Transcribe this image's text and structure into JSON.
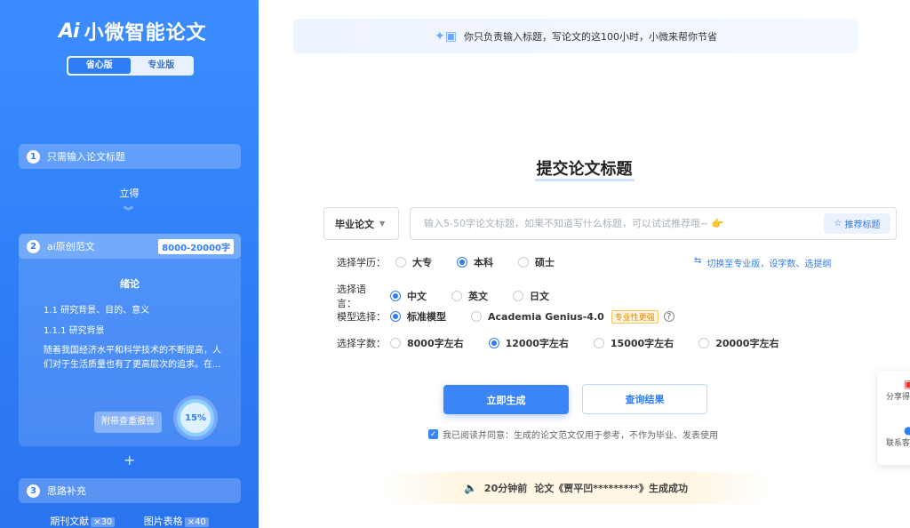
{
  "sidebar": {
    "logo_mark": "Ai",
    "logo_text": "小微智能论文",
    "modes": [
      {
        "label": "省心版",
        "active": true
      },
      {
        "label": "专业版",
        "active": false
      }
    ],
    "step1": {
      "num": "1",
      "label": "只需输入论文标题"
    },
    "standing": "立得",
    "step2": {
      "num": "2",
      "label": "ai原创范文",
      "tag": "8000-20000字"
    },
    "draft": {
      "title": "绪论",
      "line1": "1.1 研究背景、目的、意义",
      "line2": "1.1.1 研究背景",
      "body": "随着我国经济水平和科学技术的不断提高，人们对于生活质量也有了更高层次的追求。在..."
    },
    "report_label": "附带查重报告",
    "progress": "15%",
    "step3": {
      "num": "3",
      "label": "思路补充"
    },
    "extras": [
      {
        "label": "期刊文献",
        "count": "×30"
      },
      {
        "label": "图片表格",
        "count": "×40"
      }
    ]
  },
  "banner": {
    "text": "你只负责输入标题，写论文的这100小时，小微来帮你节省"
  },
  "main": {
    "heading": "提交论文标题",
    "type_select": "毕业论文",
    "input_placeholder": "输入5-50字论文标题，如果不知道写什么标题，可以试试推荐哦~ 👉",
    "recommend_label": "推荐标题",
    "switch_link": "切换至专业版，设字数、选提纲",
    "education": {
      "label": "选择学历：",
      "options": [
        {
          "label": "大专",
          "checked": false
        },
        {
          "label": "本科",
          "checked": true
        },
        {
          "label": "硕士",
          "checked": false
        }
      ]
    },
    "language": {
      "label": "选择语言：",
      "options": [
        {
          "label": "中文",
          "checked": true
        },
        {
          "label": "英文",
          "checked": false
        },
        {
          "label": "日文",
          "checked": false
        }
      ]
    },
    "model": {
      "label": "模型选择：",
      "options": [
        {
          "label": "标准模型",
          "checked": true
        },
        {
          "label": "Academia Genius-4.0",
          "checked": false
        }
      ],
      "badge": "专业性更强"
    },
    "words": {
      "label": "选择字数：",
      "options": [
        {
          "label": "8000字左右",
          "checked": false
        },
        {
          "label": "12000字左右",
          "checked": true
        },
        {
          "label": "15000字左右",
          "checked": false
        },
        {
          "label": "20000字左右",
          "checked": false
        }
      ]
    },
    "generate_label": "立即生成",
    "query_label": "查询结果",
    "agree_text": "我已阅读并同意：生成的论文范文仅用于参考，不作为毕业、发表使用",
    "notice": {
      "time": "20分钟前",
      "message": "论文《贾平凹*********》生成成功"
    }
  },
  "float_panel": {
    "share": "分享得",
    "contact": "联系客"
  }
}
